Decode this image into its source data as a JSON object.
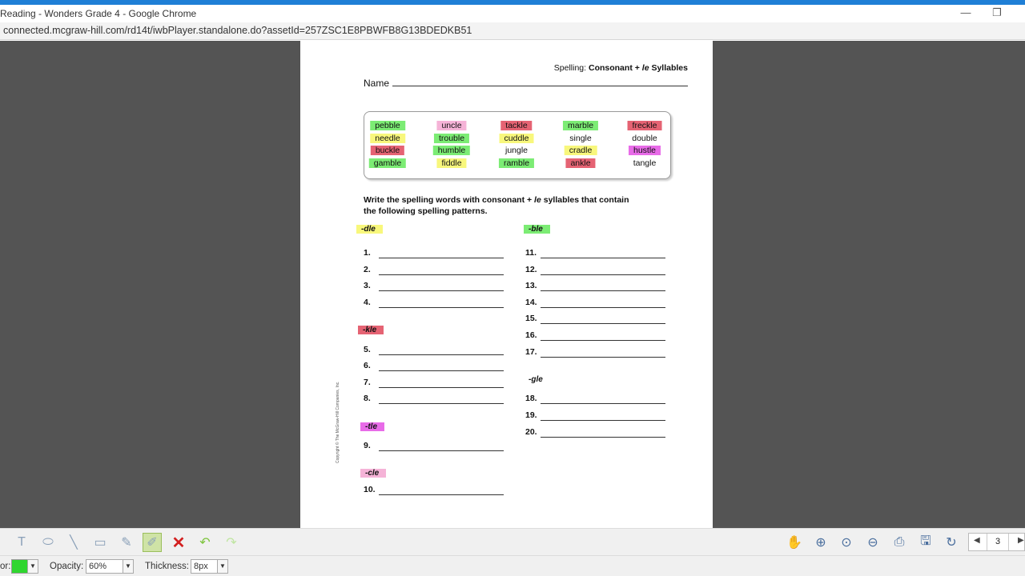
{
  "window": {
    "title": "Reading - Wonders Grade 4 - Google Chrome",
    "minimize_glyph": "—",
    "restore_glyph": "❐"
  },
  "address": {
    "url": "connected.mcgraw-hill.com/rd14t/iwbPlayer.standalone.do?assetId=257ZSC1E8PBWFB8G13BDEDKB51"
  },
  "worksheet": {
    "header_prefix": "Spelling: ",
    "header_title_a": "Consonant + ",
    "header_title_le": "le",
    "header_title_b": " Syllables",
    "name_label": "Name",
    "instruction_a": "Write the spelling words with consonant + ",
    "instruction_le": "le",
    "instruction_b": " syllables that contain the following spelling patterns.",
    "copyright": "Copyright © The McGraw-Hill Companies, Inc.",
    "words": [
      {
        "text": "pebble",
        "highlight": "green"
      },
      {
        "text": "uncle",
        "highlight": "pink"
      },
      {
        "text": "tackle",
        "highlight": "red"
      },
      {
        "text": "marble",
        "highlight": "green"
      },
      {
        "text": "freckle",
        "highlight": "red"
      },
      {
        "text": "needle",
        "highlight": "yellow"
      },
      {
        "text": "trouble",
        "highlight": "green"
      },
      {
        "text": "cuddle",
        "highlight": "yellow"
      },
      {
        "text": "single",
        "highlight": "none"
      },
      {
        "text": "double",
        "highlight": "none"
      },
      {
        "text": "buckle",
        "highlight": "red"
      },
      {
        "text": "humble",
        "highlight": "green"
      },
      {
        "text": "jungle",
        "highlight": "none"
      },
      {
        "text": "cradle",
        "highlight": "yellow"
      },
      {
        "text": "hustle",
        "highlight": "magenta"
      },
      {
        "text": "gamble",
        "highlight": "green"
      },
      {
        "text": "fiddle",
        "highlight": "yellow"
      },
      {
        "text": "ramble",
        "highlight": "green"
      },
      {
        "text": "ankle",
        "highlight": "red"
      },
      {
        "text": "tangle",
        "highlight": "none"
      }
    ],
    "patterns": [
      {
        "text": "-dle",
        "highlight": "yellow"
      },
      {
        "text": "-ble",
        "highlight": "green"
      },
      {
        "text": "-kle",
        "highlight": "red"
      },
      {
        "text": "-gle",
        "highlight": "none"
      },
      {
        "text": "-tle",
        "highlight": "magenta"
      },
      {
        "text": "-cle",
        "highlight": "pink"
      }
    ],
    "numbers": [
      "1.",
      "2.",
      "3.",
      "4.",
      "5.",
      "6.",
      "7.",
      "8.",
      "9.",
      "10.",
      "11.",
      "12.",
      "13.",
      "14.",
      "15.",
      "16.",
      "17.",
      "18.",
      "19.",
      "20."
    ]
  },
  "toolbar": {
    "tools": [
      {
        "name": "text-tool-icon",
        "glyph": "T"
      },
      {
        "name": "ellipse-tool-icon",
        "glyph": "⬭"
      },
      {
        "name": "line-tool-icon",
        "glyph": "╲"
      },
      {
        "name": "rectangle-tool-icon",
        "glyph": "▭"
      },
      {
        "name": "pencil-tool-icon",
        "glyph": "✎"
      },
      {
        "name": "highlighter-tool-icon",
        "glyph": "✐"
      },
      {
        "name": "delete-icon",
        "glyph": "✕"
      },
      {
        "name": "undo-icon",
        "glyph": "↶"
      },
      {
        "name": "redo-icon",
        "glyph": "↷"
      }
    ],
    "right_tools": [
      {
        "name": "hand-pan-icon",
        "glyph": "✋"
      },
      {
        "name": "zoom-in-icon",
        "glyph": "⊕"
      },
      {
        "name": "zoom-fit-icon",
        "glyph": "⊙"
      },
      {
        "name": "zoom-out-icon",
        "glyph": "⊖"
      },
      {
        "name": "print-icon",
        "glyph": "⎙"
      },
      {
        "name": "save-icon",
        "glyph": "🖫"
      },
      {
        "name": "refresh-icon",
        "glyph": "↻"
      }
    ],
    "page_number": "3",
    "prev_glyph": "◀",
    "next_glyph": "▶"
  },
  "options": {
    "color_label": "or:",
    "color_value": "#2fd62f",
    "opacity_label": "Opacity:",
    "opacity_value": "60%",
    "thickness_label": "Thickness:",
    "thickness_value": "8px",
    "dropdown_glyph": "▼"
  }
}
